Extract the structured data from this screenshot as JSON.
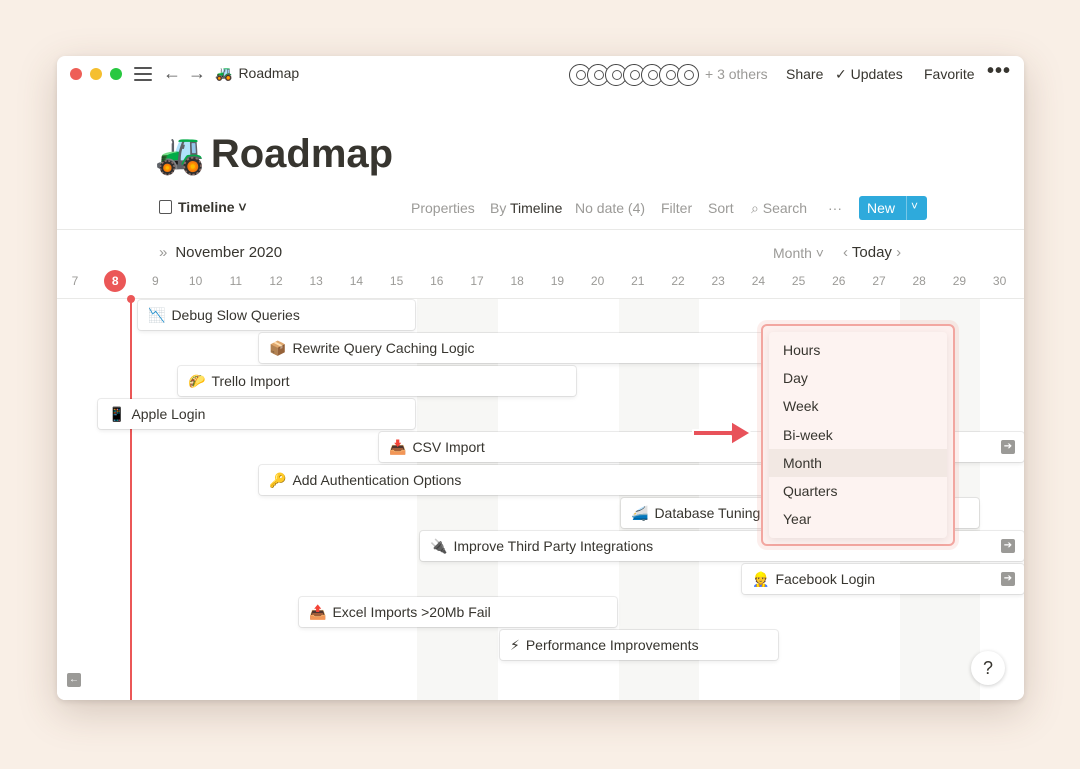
{
  "titlebar": {
    "breadcrumb_emoji": "🚜",
    "breadcrumb": "Roadmap",
    "others": "+ 3 others",
    "share": "Share",
    "updates": "Updates",
    "favorite": "Favorite",
    "more": "•••"
  },
  "page": {
    "emoji": "🚜",
    "title": "Roadmap"
  },
  "viewbar": {
    "view": "Timeline",
    "properties": "Properties",
    "by_label": "By",
    "by_value": "Timeline",
    "no_date": "No date (4)",
    "filter": "Filter",
    "sort": "Sort",
    "search": "Search",
    "more": "···",
    "new": "New"
  },
  "timeline": {
    "month": "November 2020",
    "scale": "Month",
    "today": "Today",
    "days": [
      "7",
      "8",
      "9",
      "10",
      "11",
      "12",
      "13",
      "14",
      "15",
      "16",
      "17",
      "18",
      "19",
      "20",
      "21",
      "22",
      "23",
      "24",
      "25",
      "26",
      "27",
      "28",
      "29",
      "30"
    ],
    "today_day": "8"
  },
  "tasks": [
    {
      "emoji": "📉",
      "name": "Debug Slow Queries"
    },
    {
      "emoji": "📦",
      "name": "Rewrite Query Caching Logic"
    },
    {
      "emoji": "🌮",
      "name": "Trello Import"
    },
    {
      "emoji": "📱",
      "name": "Apple Login"
    },
    {
      "emoji": "📥",
      "name": "CSV Import"
    },
    {
      "emoji": "🔑",
      "name": "Add Authentication Options"
    },
    {
      "emoji": "🚄",
      "name": "Database Tuning"
    },
    {
      "emoji": "🔌",
      "name": "Improve Third Party Integrations"
    },
    {
      "emoji": "👷",
      "name": "Facebook Login"
    },
    {
      "emoji": "📤",
      "name": "Excel Imports >20Mb Fail"
    },
    {
      "emoji": "⚡",
      "name": "Performance Improvements"
    }
  ],
  "dropdown": {
    "options": [
      "Hours",
      "Day",
      "Week",
      "Bi-week",
      "Month",
      "Quarters",
      "Year"
    ],
    "selected": "Month"
  },
  "help": "?",
  "colors": {
    "accent": "#2eaadc",
    "today": "#eb5757",
    "highlight": "#f2a6a0"
  }
}
